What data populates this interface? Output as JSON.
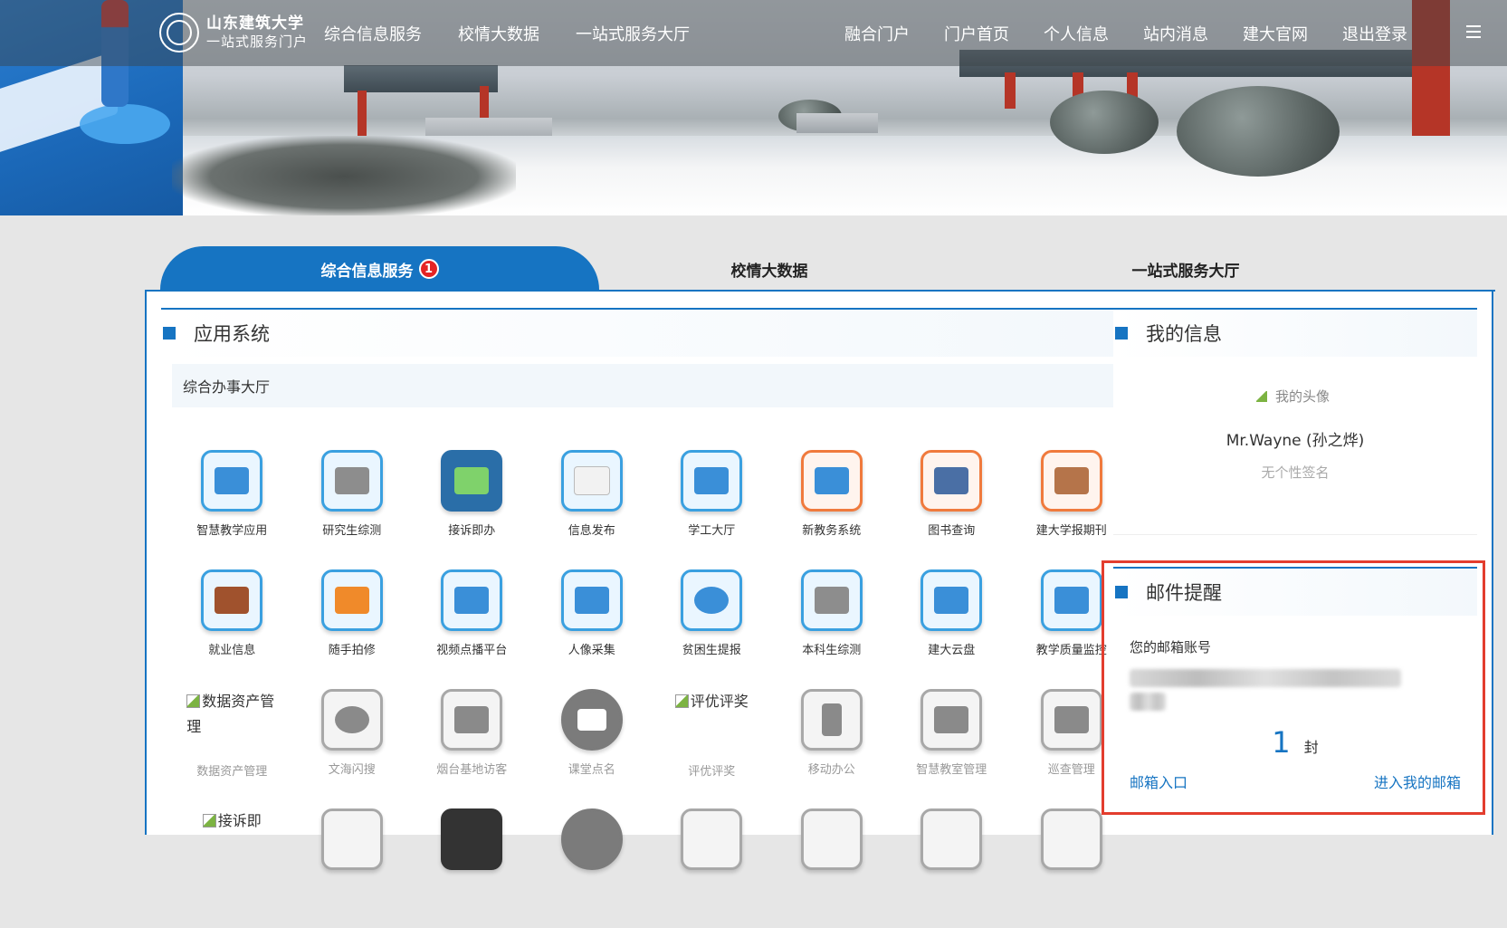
{
  "header": {
    "logo": {
      "name": "山东建筑大学",
      "subtitle": "一站式服务门户"
    },
    "nav_left": [
      "综合信息服务",
      "校情大数据",
      "一站式服务大厅"
    ],
    "nav_right": [
      "融合门户",
      "门户首页",
      "个人信息",
      "站内消息",
      "建大官网",
      "退出登录"
    ],
    "menu_icon": "hamburger-icon"
  },
  "tabs": [
    {
      "label": "综合信息服务",
      "badge": "1",
      "active": true
    },
    {
      "label": "校情大数据"
    },
    {
      "label": "一站式服务大厅"
    }
  ],
  "apps_section": {
    "title": "应用系统",
    "subheading": "综合办事大厅",
    "apps": [
      {
        "label": "智慧教学应用",
        "icon": "monitor-icon"
      },
      {
        "label": "研究生综测",
        "icon": "book-stack-icon"
      },
      {
        "label": "接诉即办",
        "icon": "approval-icon"
      },
      {
        "label": "信息发布",
        "icon": "envelope-icon"
      },
      {
        "label": "学工大厅",
        "icon": "staff-icon"
      },
      {
        "label": "新教务系统",
        "icon": "teacher-icon"
      },
      {
        "label": "图书查询",
        "icon": "books-icon"
      },
      {
        "label": "建大学报期刊",
        "icon": "journal-icon"
      },
      {
        "label": "就业信息",
        "icon": "briefcase-icon"
      },
      {
        "label": "随手拍修",
        "icon": "tools-icon"
      },
      {
        "label": "视频点播平台",
        "icon": "video-icon"
      },
      {
        "label": "人像采集",
        "icon": "id-card-icon"
      },
      {
        "label": "贫困生提报",
        "icon": "heart-icon"
      },
      {
        "label": "本科生综测",
        "icon": "book-stack-icon"
      },
      {
        "label": "建大云盘",
        "icon": "presentation-icon"
      },
      {
        "label": "教学质量监控",
        "icon": "document-edit-icon"
      },
      {
        "label": "数据资产管理",
        "icon": "broken-image-icon",
        "alt": "数据资产管理"
      },
      {
        "label": "文海闪搜",
        "icon": "globe-icon"
      },
      {
        "label": "烟台基地访客",
        "icon": "visitor-icon"
      },
      {
        "label": "课堂点名",
        "icon": "roll-call-icon"
      },
      {
        "label": "评优评奖",
        "icon": "broken-image-icon",
        "alt": "评优评奖"
      },
      {
        "label": "移动办公",
        "icon": "mobile-icon"
      },
      {
        "label": "智慧教室管理",
        "icon": "classroom-icon"
      },
      {
        "label": "巡查管理",
        "icon": "presentation-icon"
      }
    ],
    "partial_row_first_alt": "接诉即"
  },
  "my_info": {
    "title": "我的信息",
    "avatar_alt": "我的头像",
    "username": "Mr.Wayne (孙之烨)",
    "signature": "无个性签名"
  },
  "mail": {
    "title": "邮件提醒",
    "account_label": "您的邮箱账号",
    "count": "1",
    "unit": "封",
    "link_inbox": "邮箱入口",
    "link_my_mail": "进入我的邮箱"
  },
  "colors": {
    "accent": "#1674c2",
    "badge": "#e52424",
    "highlight_outline": "#e33d2e"
  }
}
